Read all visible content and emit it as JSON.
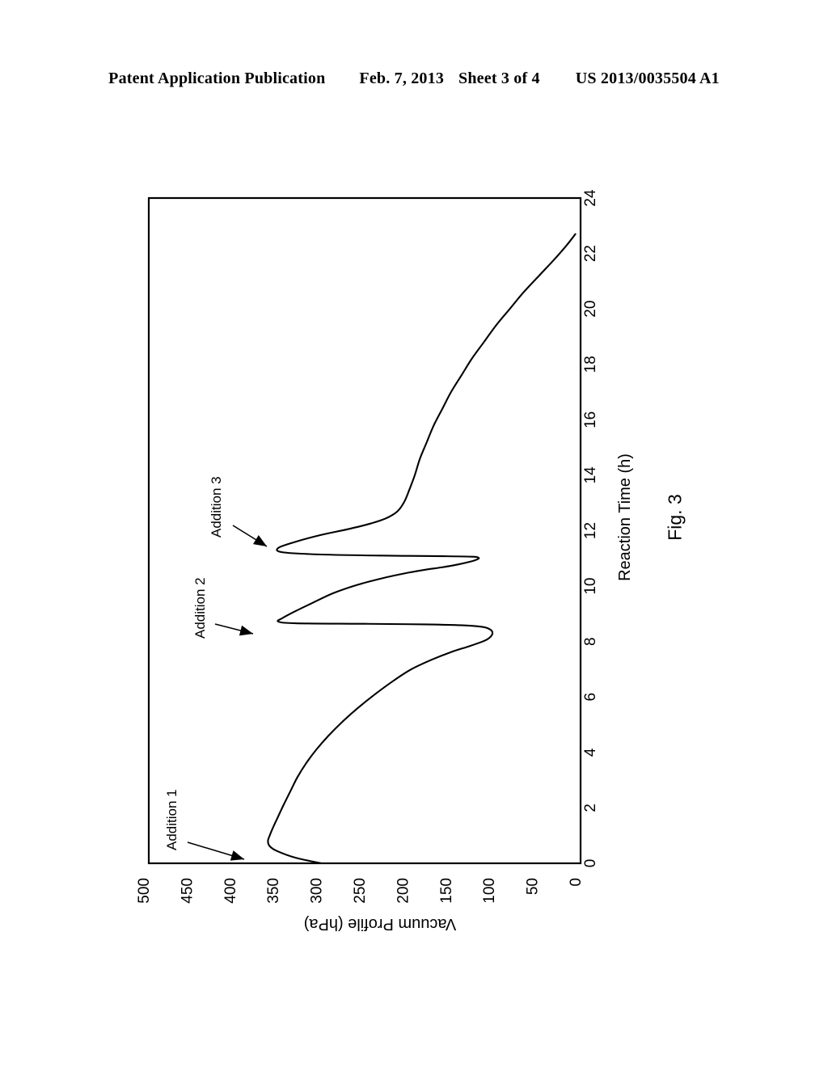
{
  "header": {
    "publication": "Patent Application Publication",
    "date": "Feb. 7, 2013",
    "sheet": "Sheet 3 of 4",
    "docnum": "US 2013/0035504 A1"
  },
  "figure": {
    "caption": "Fig. 3"
  },
  "chart_data": {
    "type": "line",
    "title": "",
    "xlabel": "Reaction Time (h)",
    "ylabel": "Vacuum Profile (hPa)",
    "xlim": [
      0,
      24
    ],
    "ylim": [
      0,
      500
    ],
    "xticks": [
      "0",
      "2",
      "4",
      "6",
      "8",
      "10",
      "12",
      "14",
      "16",
      "18",
      "20",
      "22",
      "24"
    ],
    "yticks": [
      "500",
      "450",
      "400",
      "350",
      "300",
      "250",
      "200",
      "150",
      "100",
      "50",
      "0"
    ],
    "grid": true,
    "legend": "none",
    "rotation_deg": 90,
    "series": [
      {
        "name": "Vacuum Profile",
        "x": [
          0.0,
          0.2,
          0.45,
          0.62,
          0.8,
          1.0,
          1.3,
          1.7,
          2.1,
          2.6,
          3.1,
          3.6,
          4.1,
          4.6,
          5.1,
          5.6,
          6.1,
          6.6,
          7.0,
          7.35,
          7.62,
          7.82,
          7.97,
          8.08,
          8.18,
          8.3,
          8.42,
          8.52,
          8.58,
          8.62,
          8.64,
          8.66,
          8.72,
          8.85,
          9.1,
          9.4,
          9.75,
          10.05,
          10.28,
          10.45,
          10.58,
          10.68,
          10.78,
          10.88,
          10.96,
          11.02,
          11.06,
          11.08,
          11.1,
          11.14,
          11.22,
          11.38,
          11.6,
          11.85,
          12.05,
          12.25,
          12.45,
          12.7,
          13.05,
          13.5,
          14.0,
          14.6,
          15.2,
          15.8,
          16.4,
          17.0,
          17.6,
          18.2,
          18.8,
          19.4,
          20.0,
          20.6,
          21.2,
          21.8,
          22.3,
          22.7
        ],
        "y": [
          300,
          330,
          352,
          360,
          362,
          360,
          356,
          350,
          344,
          336,
          328,
          318,
          306,
          292,
          276,
          258,
          238,
          216,
          196,
          172,
          150,
          130,
          116,
          108,
          104,
          102,
          104,
          112,
          132,
          180,
          250,
          330,
          350,
          345,
          330,
          310,
          286,
          258,
          230,
          205,
          182,
          160,
          142,
          128,
          120,
          118,
          125,
          160,
          230,
          300,
          345,
          350,
          330,
          300,
          270,
          244,
          225,
          212,
          204,
          198,
          192,
          186,
          178,
          170,
          160,
          150,
          138,
          126,
          112,
          98,
          82,
          66,
          48,
          30,
          16,
          6
        ]
      }
    ],
    "annotations": [
      {
        "label": "Addition 1",
        "time_h": 0.65,
        "pressure_hpa": 360
      },
      {
        "label": "Addition 2",
        "time_h": 8.65,
        "pressure_hpa": 350
      },
      {
        "label": "Addition 3",
        "time_h": 11.1,
        "pressure_hpa": 350
      }
    ]
  }
}
